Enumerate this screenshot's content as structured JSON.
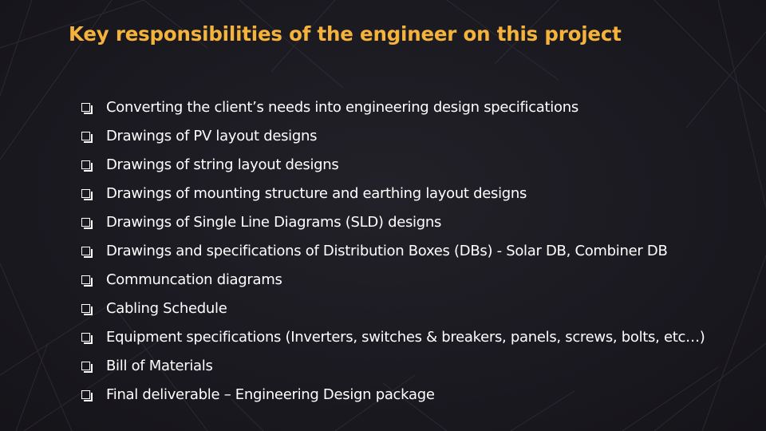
{
  "slide": {
    "title": "Key responsibilities of the engineer on this project",
    "title_color": "#f5b33c",
    "text_color": "#ffffff",
    "background_color": "#1b1a20",
    "bullet_icon": "square-checkbox-bullet-icon",
    "items": [
      "Converting the client’s needs into engineering design specifications",
      "Drawings of PV layout designs",
      "Drawings of string layout designs",
      "Drawings of mounting structure and earthing layout designs",
      "Drawings of Single Line Diagrams (SLD) designs",
      "Drawings and specifications of Distribution Boxes (DBs) - Solar DB, Combiner DB",
      "Communcation diagrams",
      "Cabling Schedule",
      "Equipment specifications (Inverters, switches & breakers, panels, screws, bolts, etc…)",
      "Bill of Materials",
      "Final deliverable – Engineering Design package"
    ]
  }
}
